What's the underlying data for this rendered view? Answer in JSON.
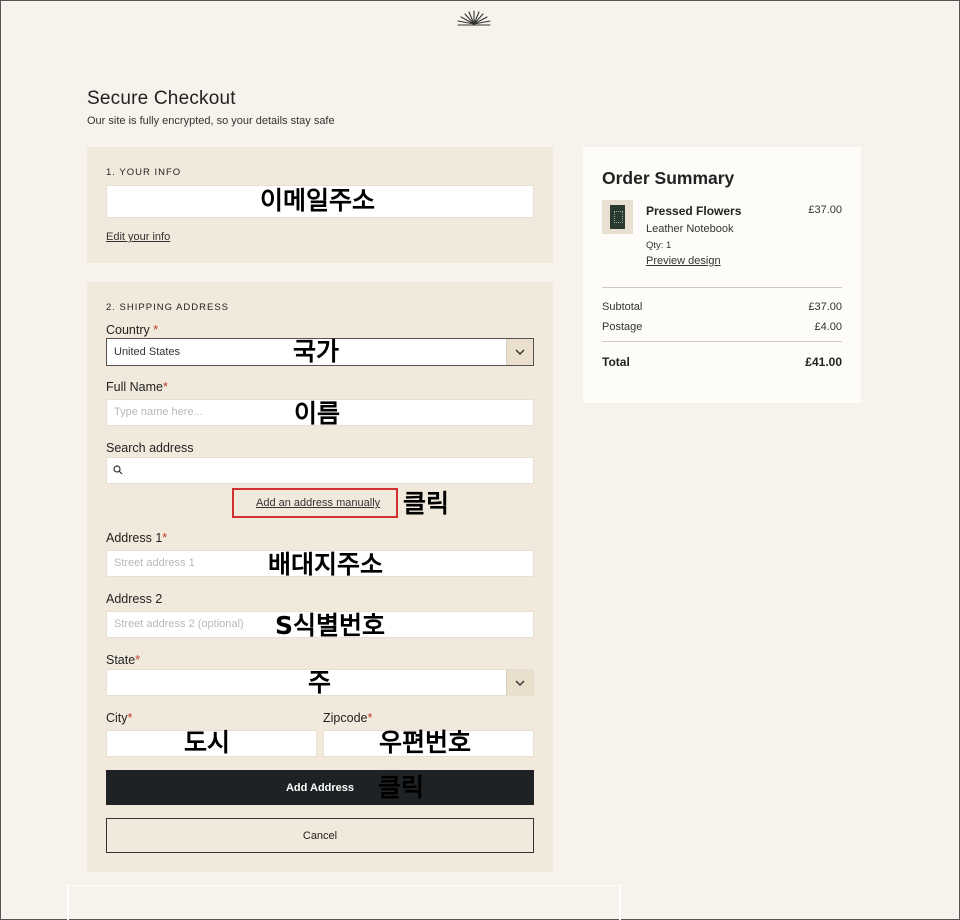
{
  "header": {
    "logo_icon": "sunburst-logo-icon",
    "title": "Secure Checkout",
    "subtitle": "Our site is fully encrypted, so your details stay safe"
  },
  "your_info": {
    "section_label": "1. YOUR INFO",
    "email_annotation": "이메일주소",
    "edit_link": "Edit your info"
  },
  "shipping": {
    "section_label": "2. SHIPPING ADDRESS",
    "country_label": "Country",
    "country_value": "United States",
    "country_annotation": "국가",
    "full_name_label": "Full Name",
    "full_name_placeholder": "Type name here...",
    "full_name_annotation": "이름",
    "search_label": "Search address",
    "manual_link": "Add an address manually",
    "manual_annotation": "클릭",
    "address1_label": "Address 1",
    "address1_placeholder": "Street address 1",
    "address1_annotation": "배대지주소",
    "address2_label": "Address 2",
    "address2_placeholder": "Street address 2 (optional)",
    "address2_annotation": "S식별번호",
    "state_label": "State",
    "state_annotation": "주",
    "city_label": "City",
    "city_annotation": "도시",
    "zipcode_label": "Zipcode",
    "zipcode_annotation": "우편번호",
    "add_button": "Add Address",
    "add_annotation": "클릭",
    "cancel_button": "Cancel",
    "required_marker": "*"
  },
  "summary": {
    "title": "Order Summary",
    "product_name": "Pressed Flowers",
    "product_price": "£37.00",
    "product_variant": "Leather Notebook",
    "product_qty": "Qty: 1",
    "preview_link": "Preview design",
    "subtotal_label": "Subtotal",
    "subtotal_value": "£37.00",
    "postage_label": "Postage",
    "postage_value": "£4.00",
    "total_label": "Total",
    "total_value": "£41.00"
  },
  "colors": {
    "page_bg": "#f7f3ec",
    "card_bg": "#f1eadc",
    "button_dark": "#1f2224",
    "highlight_red": "#d23030",
    "required_red": "#c0392b"
  }
}
